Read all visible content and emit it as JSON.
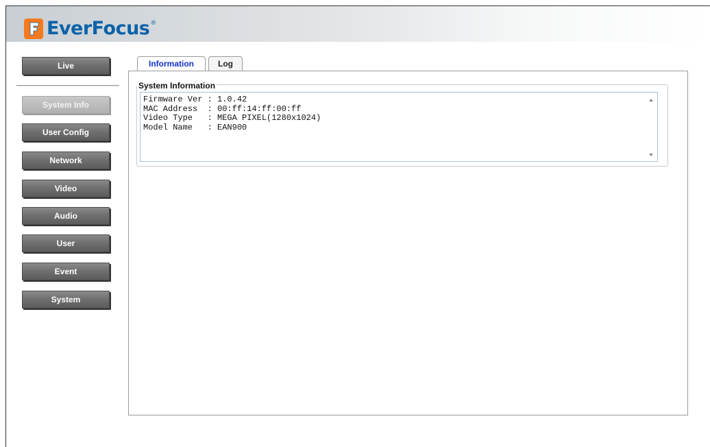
{
  "brand": {
    "name": "EverFocus",
    "registered_mark": "®",
    "logo_color": "#0d62a8",
    "mark_color": "#f47a20"
  },
  "sidebar": {
    "items": [
      {
        "label": "Live",
        "active": false
      },
      {
        "label": "System Info",
        "active": true
      },
      {
        "label": "User Config",
        "active": false
      },
      {
        "label": "Network",
        "active": false
      },
      {
        "label": "Video",
        "active": false
      },
      {
        "label": "Audio",
        "active": false
      },
      {
        "label": "User",
        "active": false
      },
      {
        "label": "Event",
        "active": false
      },
      {
        "label": "System",
        "active": false
      }
    ]
  },
  "tabs": [
    {
      "label": "Information",
      "active": true
    },
    {
      "label": "Log",
      "active": false
    }
  ],
  "system_information": {
    "legend": "System Information",
    "lines": [
      "Firmware Ver : 1.0.42",
      "MAC Address  : 00:ff:14:ff:00:ff",
      "Video Type   : MEGA PIXEL(1280x1024)",
      "Model Name   : EAN900"
    ]
  }
}
